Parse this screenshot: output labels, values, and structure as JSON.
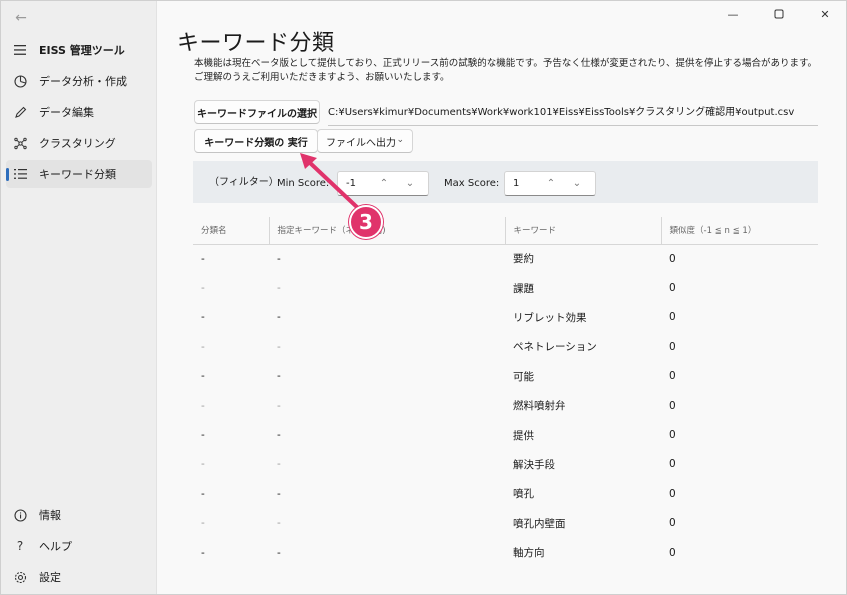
{
  "sidebar": {
    "app_title": "EISS 管理ツール",
    "items": [
      {
        "label": "データ分析・作成",
        "icon": "pie-chart-icon"
      },
      {
        "label": "データ編集",
        "icon": "pencil-icon"
      },
      {
        "label": "クラスタリング",
        "icon": "cluster-icon"
      },
      {
        "label": "キーワード分類",
        "icon": "list-icon"
      }
    ],
    "bottom_items": [
      {
        "label": "情報",
        "icon": "info-icon"
      },
      {
        "label": "ヘルプ",
        "icon": "help-icon"
      },
      {
        "label": "設定",
        "icon": "gear-icon"
      }
    ]
  },
  "main": {
    "title": "キーワード分類",
    "notice_line1": "本機能は現在ベータ版として提供しており、正式リリース前の試験的な機能です。予告なく仕様が変更されたり、提供を停止する場合があります。",
    "notice_line2": "ご理解のうえご利用いただきますよう、お願いいたします。",
    "select_file_button": "キーワードファイルの選択",
    "file_path": "C:¥Users¥kimur¥Documents¥Work¥work101¥Eiss¥EissTools¥クラスタリング確認用¥output.csv",
    "run_button": "キーワード分類の  実行",
    "export_button": "ファイルへ出力",
    "filter": {
      "label": "（フィルター）",
      "min_label": "Min Score:",
      "min_value": "-1",
      "max_label": "Max Score:",
      "max_value": "1"
    },
    "table": {
      "headers": [
        "分類名",
        "指定キーワード（ネ          は平均)",
        "キーワード",
        "類似度（-1 ≦ n ≦ 1）"
      ],
      "rows": [
        [
          "-",
          "-",
          "要約",
          "0"
        ],
        [
          "-",
          "-",
          "課題",
          "0"
        ],
        [
          "-",
          "-",
          "リブレット効果",
          "0"
        ],
        [
          "-",
          "-",
          "ペネトレーション",
          "0"
        ],
        [
          "-",
          "-",
          "可能",
          "0"
        ],
        [
          "-",
          "-",
          "燃料噴射弁",
          "0"
        ],
        [
          "-",
          "-",
          "提供",
          "0"
        ],
        [
          "-",
          "-",
          "解決手段",
          "0"
        ],
        [
          "-",
          "-",
          "噴孔",
          "0"
        ],
        [
          "-",
          "-",
          "噴孔内壁面",
          "0"
        ],
        [
          "-",
          "-",
          "軸方向",
          "0"
        ]
      ]
    },
    "callout_number": "3"
  },
  "colors": {
    "accent": "#2d6dbc",
    "callout": "#e0336b"
  }
}
